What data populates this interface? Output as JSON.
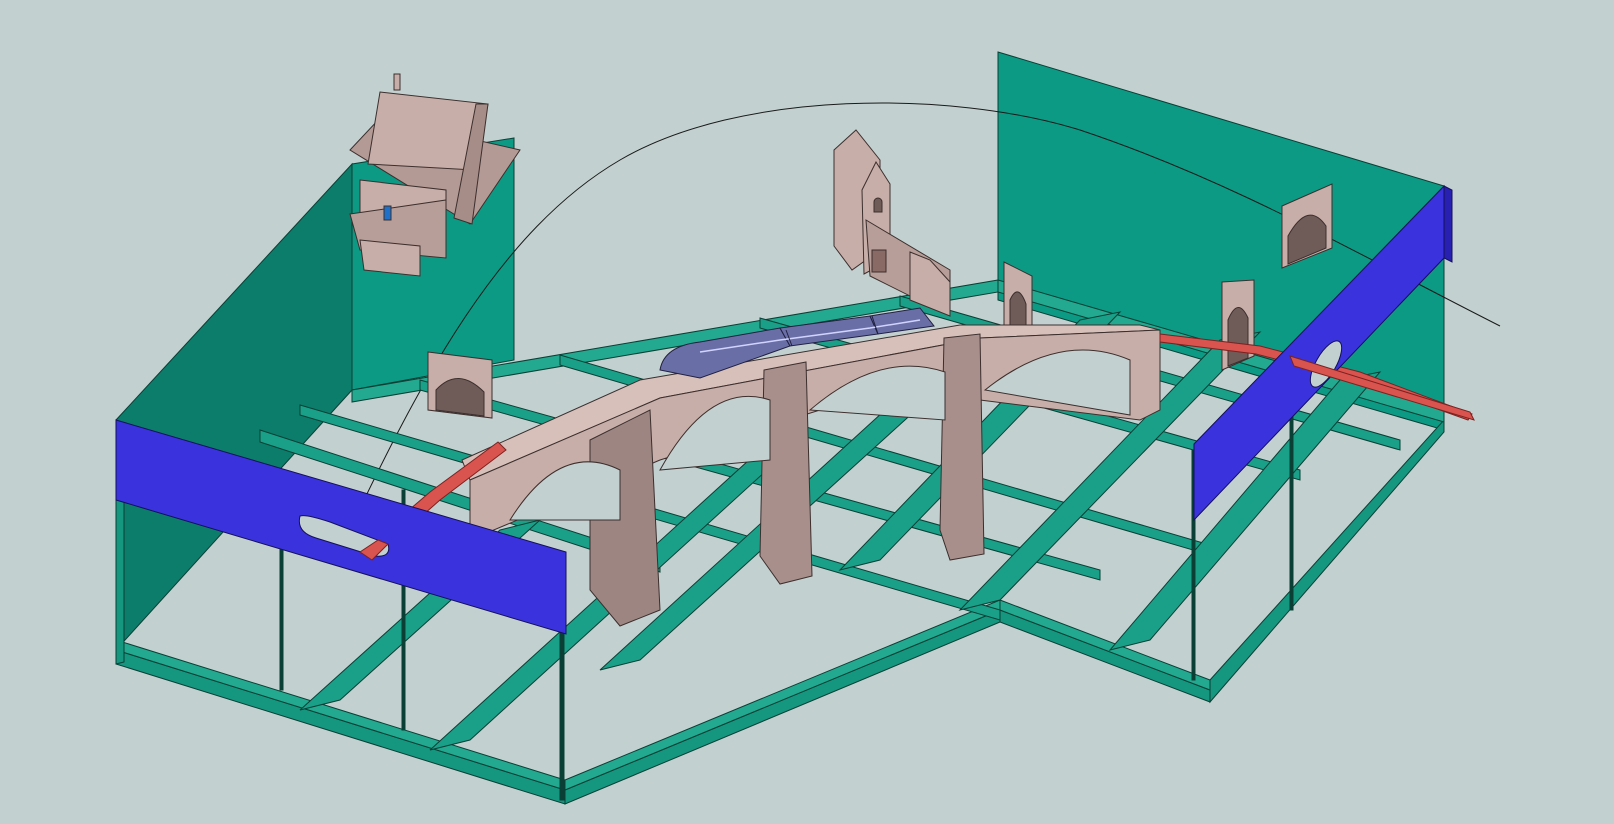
{
  "scene": {
    "background_color": "#c3d0d0",
    "colors": {
      "frame_teal": "#14967f",
      "frame_teal_dark": "#0b7d6a",
      "backdrop_teal": "#0c9a84",
      "fascia_blue": "#3a32dc",
      "fascia_blue_dark": "#2820b0",
      "viaduct_stone": "#c8aea8",
      "viaduct_shadow": "#9d8582",
      "track_red": "#d9534f",
      "train_body": "#6a6ea6",
      "building_stone": "#c8aea8"
    },
    "objects": [
      {
        "name": "benchwork-frame",
        "icon": "grid-frame"
      },
      {
        "name": "backdrop-left",
        "icon": "panel"
      },
      {
        "name": "backdrop-right",
        "icon": "panel"
      },
      {
        "name": "fascia-left",
        "icon": "panel"
      },
      {
        "name": "fascia-right",
        "icon": "panel"
      },
      {
        "name": "stone-viaduct",
        "icon": "bridge"
      },
      {
        "name": "rail-train",
        "icon": "train"
      },
      {
        "name": "house-building",
        "icon": "house"
      },
      {
        "name": "church-building",
        "icon": "church"
      },
      {
        "name": "tunnel-portals",
        "icon": "tunnel"
      },
      {
        "name": "track-ribbon",
        "icon": "track"
      }
    ]
  }
}
